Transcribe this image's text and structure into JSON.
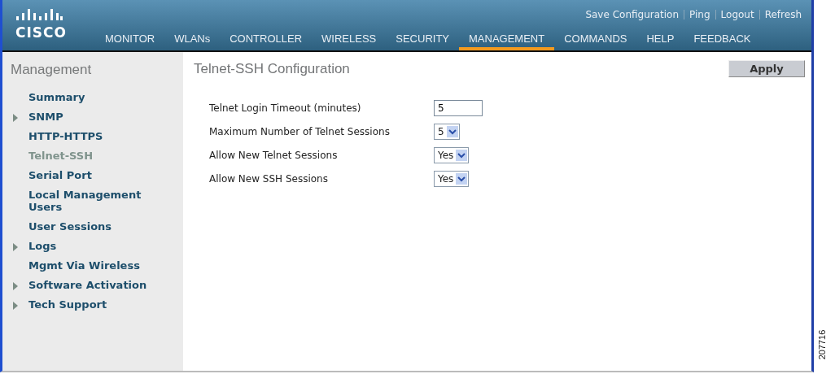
{
  "header": {
    "logo": "CISCO",
    "links": [
      "Save Configuration",
      "Ping",
      "Logout",
      "Refresh"
    ],
    "nav": [
      {
        "label": "MONITOR",
        "selected": false
      },
      {
        "label": "WLANs",
        "selected": false
      },
      {
        "label": "CONTROLLER",
        "selected": false
      },
      {
        "label": "WIRELESS",
        "selected": false
      },
      {
        "label": "SECURITY",
        "selected": false
      },
      {
        "label": "MANAGEMENT",
        "selected": true
      },
      {
        "label": "COMMANDS",
        "selected": false
      },
      {
        "label": "HELP",
        "selected": false
      },
      {
        "label": "FEEDBACK",
        "selected": false
      }
    ]
  },
  "sidebar": {
    "title": "Management",
    "items": [
      {
        "label": "Summary",
        "expandable": false,
        "selected": false
      },
      {
        "label": "SNMP",
        "expandable": true,
        "selected": false
      },
      {
        "label": "HTTP-HTTPS",
        "expandable": false,
        "selected": false
      },
      {
        "label": "Telnet-SSH",
        "expandable": false,
        "selected": true
      },
      {
        "label": "Serial Port",
        "expandable": false,
        "selected": false
      },
      {
        "label": "Local Management Users",
        "expandable": false,
        "selected": false
      },
      {
        "label": "User Sessions",
        "expandable": false,
        "selected": false
      },
      {
        "label": "Logs",
        "expandable": true,
        "selected": false
      },
      {
        "label": "Mgmt Via Wireless",
        "expandable": false,
        "selected": false
      },
      {
        "label": "Software Activation",
        "expandable": true,
        "selected": false
      },
      {
        "label": "Tech Support",
        "expandable": true,
        "selected": false
      }
    ]
  },
  "main": {
    "title": "Telnet-SSH Configuration",
    "apply": "Apply",
    "fields": [
      {
        "label": "Telnet Login Timeout (minutes)",
        "kind": "text",
        "value": "5"
      },
      {
        "label": "Maximum Number of Telnet Sessions",
        "kind": "select",
        "value": "5"
      },
      {
        "label": "Allow New Telnet Sessions",
        "kind": "select",
        "value": "Yes"
      },
      {
        "label": "Allow New SSH Sessions",
        "kind": "select",
        "value": "Yes"
      }
    ]
  },
  "figure_id": "207716"
}
